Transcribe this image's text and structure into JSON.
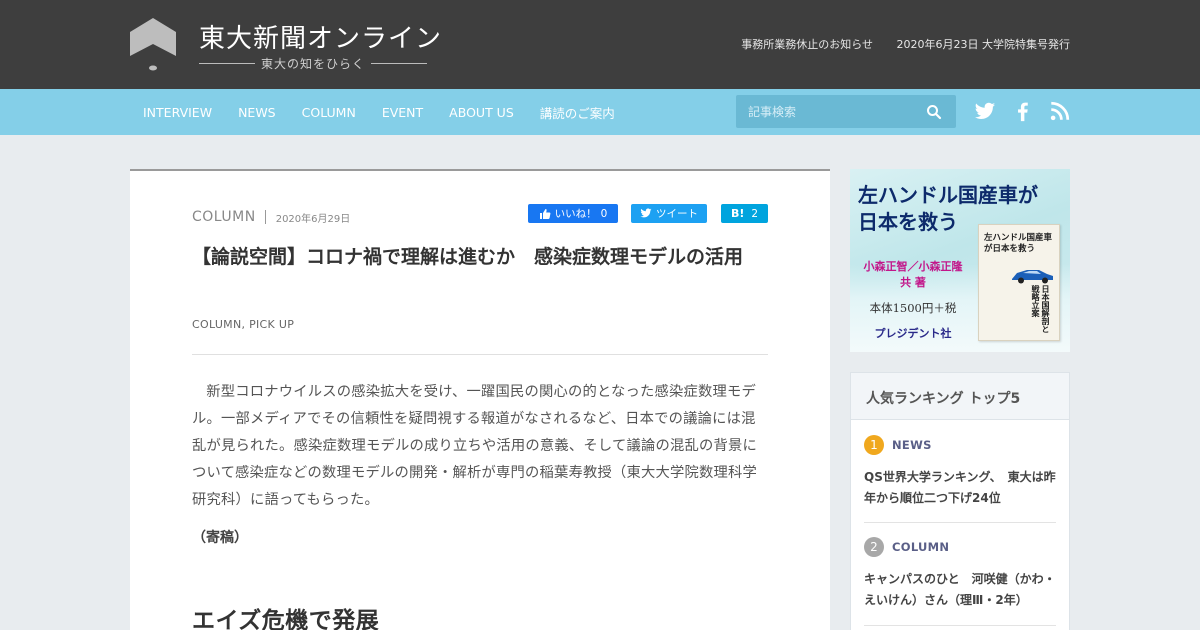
{
  "header": {
    "site_title": "東大新聞オンライン",
    "tagline": "東大の知をひらく",
    "links": [
      "事務所業務休止のお知らせ",
      "2020年6月23日 大学院特集号発行"
    ]
  },
  "nav": {
    "items": [
      "INTERVIEW",
      "NEWS",
      "COLUMN",
      "EVENT",
      "ABOUT US",
      "講読のご案内"
    ],
    "search_placeholder": "記事検索",
    "social_icons": [
      "twitter-icon",
      "facebook-icon",
      "rss-icon"
    ]
  },
  "article": {
    "category": "COLUMN",
    "date": "2020年6月29日",
    "share": {
      "facebook_label": "いいね！",
      "facebook_count": "0",
      "twitter_label": "ツイート",
      "hatena_label": "B!",
      "hatena_count": "2"
    },
    "title": "【論説空間】コロナ禍で理解は進むか　感染症数理モデルの活用",
    "tags": "COLUMN, PICK UP",
    "body": "新型コロナウイルスの感染拡大を受け、一躍国民の関心の的となった感染症数理モデル。一部メディアでその信頼性を疑問視する報道がなされるなど、日本での議論には混乱が見られた。感染症数理モデルの成り立ちや活用の意義、そして議論の混乱の背景について感染症などの数理モデルの開発・解析が専門の稲葉寿教授（東大大学院数理科学研究科）に語ってもらった。",
    "note": "（寄稿）",
    "subheading": "エイズ危機で発展"
  },
  "ad": {
    "headline_line1": "左ハンドル国産車が",
    "headline_line2": "日本を救う",
    "authors_line1": "小森正智／小森正隆",
    "authors_line2": "共 著",
    "price": "本体1500円＋税",
    "publisher": "プレジデント社",
    "book_title": "左ハンドル国産車が日本を救う",
    "book_vertical": "日本国解剖と戦略立案"
  },
  "ranking": {
    "title": "人気ランキング トップ5",
    "items": [
      {
        "rank": "1",
        "category": "NEWS",
        "text": "QS世界大学ランキング、　東大は昨年から順位二つ下げ24位",
        "color": "#f0a81e"
      },
      {
        "rank": "2",
        "category": "COLUMN",
        "text": "キャンパスのひと　河咲健（かわ・えいけん）さん（理Ⅲ・2年）",
        "color": "#a8a8a8"
      }
    ]
  },
  "colors": {
    "header_bg": "#3e3e3e",
    "nav_bg": "#84cfe8",
    "page_bg": "#e8ecef",
    "facebook": "#1877f2",
    "twitter": "#1da1f2",
    "hatena": "#00a4de"
  }
}
